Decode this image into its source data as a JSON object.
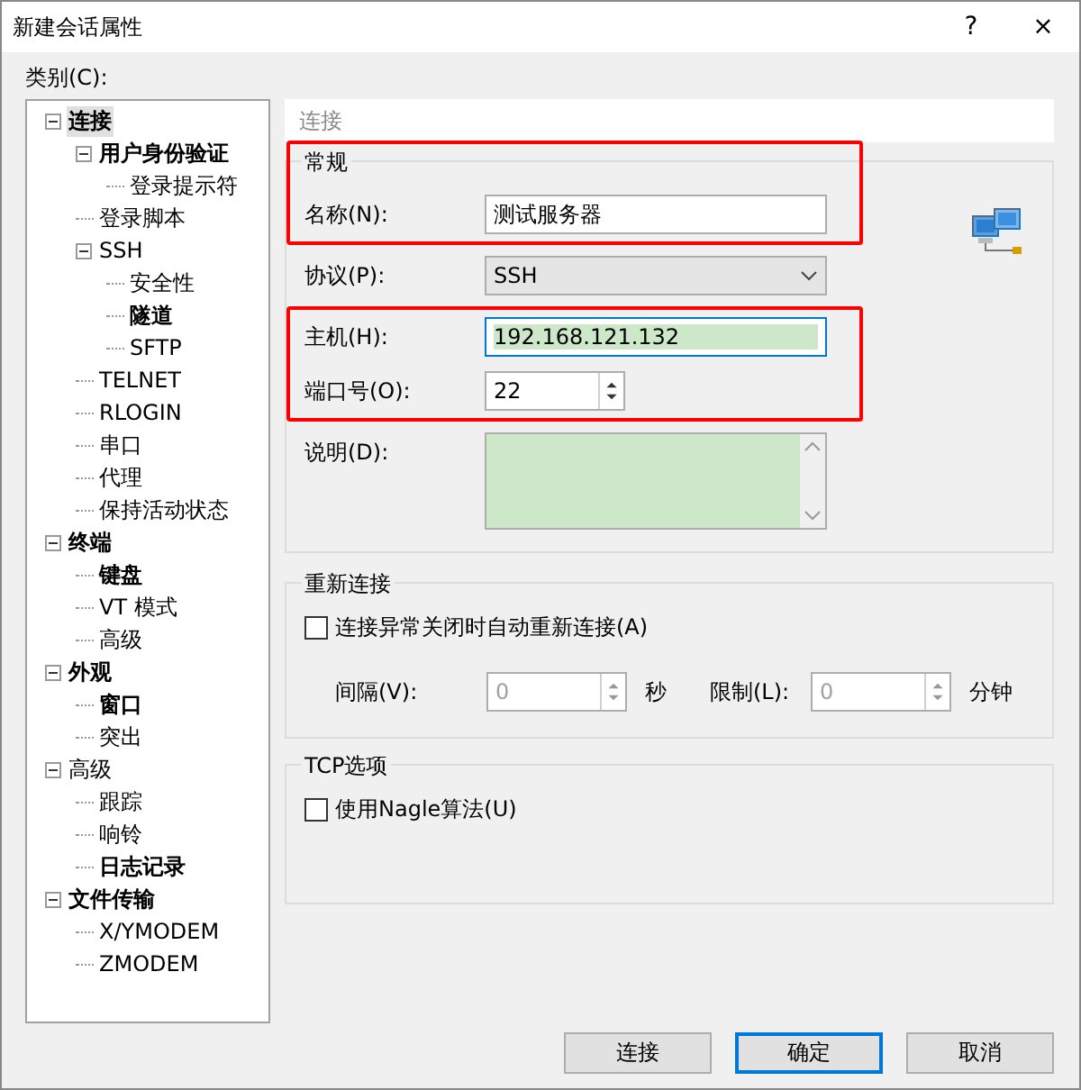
{
  "window": {
    "title": "新建会话属性",
    "help": "?",
    "close": "×"
  },
  "category_label": "类别(C):",
  "tree": [
    {
      "label": "连接",
      "bold": true,
      "selected": true,
      "expanded": true,
      "children": [
        {
          "label": "用户身份验证",
          "bold": true,
          "selected": false,
          "expanded": true,
          "children": [
            {
              "label": "登录提示符",
              "bold": false,
              "selected": false
            }
          ]
        },
        {
          "label": "登录脚本",
          "bold": false,
          "selected": false
        },
        {
          "label": "SSH",
          "bold": false,
          "selected": false,
          "expanded": true,
          "children": [
            {
              "label": "安全性",
              "bold": false,
              "selected": false
            },
            {
              "label": "隧道",
              "bold": true,
              "selected": false
            },
            {
              "label": "SFTP",
              "bold": false,
              "selected": false
            }
          ]
        },
        {
          "label": "TELNET",
          "bold": false,
          "selected": false
        },
        {
          "label": "RLOGIN",
          "bold": false,
          "selected": false
        },
        {
          "label": "串口",
          "bold": false,
          "selected": false
        },
        {
          "label": "代理",
          "bold": false,
          "selected": false
        },
        {
          "label": "保持活动状态",
          "bold": false,
          "selected": false
        }
      ]
    },
    {
      "label": "终端",
      "bold": true,
      "selected": false,
      "expanded": true,
      "children": [
        {
          "label": "键盘",
          "bold": true,
          "selected": false
        },
        {
          "label": "VT 模式",
          "bold": false,
          "selected": false
        },
        {
          "label": "高级",
          "bold": false,
          "selected": false
        }
      ]
    },
    {
      "label": "外观",
      "bold": true,
      "selected": false,
      "expanded": true,
      "children": [
        {
          "label": "窗口",
          "bold": true,
          "selected": false
        },
        {
          "label": "突出",
          "bold": false,
          "selected": false
        }
      ]
    },
    {
      "label": "高级",
      "bold": false,
      "selected": false,
      "expanded": true,
      "children": [
        {
          "label": "跟踪",
          "bold": false,
          "selected": false
        },
        {
          "label": "响铃",
          "bold": false,
          "selected": false
        },
        {
          "label": "日志记录",
          "bold": true,
          "selected": false
        }
      ]
    },
    {
      "label": "文件传输",
      "bold": true,
      "selected": false,
      "expanded": true,
      "children": [
        {
          "label": "X/YMODEM",
          "bold": false,
          "selected": false
        },
        {
          "label": "ZMODEM",
          "bold": false,
          "selected": false
        }
      ]
    }
  ],
  "panel_header": "连接",
  "general": {
    "title": "常规",
    "blocks": [
      {
        "highlighted": true,
        "rows": [
          {
            "kind": "text",
            "label": "名称(N):",
            "value": "测试服务器"
          }
        ]
      },
      {
        "highlighted": false,
        "rows": [
          {
            "kind": "select",
            "label": "协议(P):",
            "value": "SSH"
          }
        ]
      },
      {
        "highlighted": true,
        "rows": [
          {
            "kind": "text",
            "label": "主机(H):",
            "value": "192.168.121.132",
            "focused": true
          },
          {
            "kind": "spin",
            "label": "端口号(O):",
            "value": "22"
          }
        ]
      },
      {
        "highlighted": false,
        "rows": [
          {
            "kind": "textarea",
            "label": "说明(D):"
          }
        ]
      }
    ]
  },
  "reconnect": {
    "title": "重新连接",
    "checkbox": {
      "label": "连接异常关闭时自动重新连接(A)",
      "checked": false
    },
    "interval": {
      "label": "间隔(V):",
      "value": "0",
      "unit": "秒",
      "disabled": true
    },
    "limit": {
      "label": "限制(L):",
      "value": "0",
      "unit": "分钟",
      "disabled": true
    }
  },
  "tcp": {
    "title": "TCP选项",
    "checkbox": {
      "label": "使用Nagle算法(U)",
      "checked": false
    }
  },
  "buttons": [
    {
      "label": "连接",
      "default": false
    },
    {
      "label": "确定",
      "default": true
    },
    {
      "label": "取消",
      "default": false
    }
  ]
}
